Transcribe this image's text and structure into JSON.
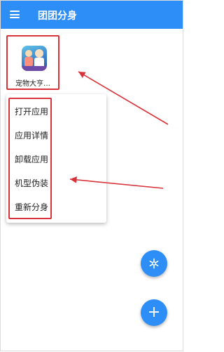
{
  "appbar": {
    "title": "团团分身",
    "menu_icon": "hamburger-menu-icon"
  },
  "app": {
    "label": "宠物大亨…",
    "icon": "pet-tycoon-app-icon"
  },
  "context_menu": {
    "items": [
      {
        "label": "打开应用"
      },
      {
        "label": "应用详情"
      },
      {
        "label": "卸载应用"
      },
      {
        "label": "机型伪装"
      },
      {
        "label": "重新分身"
      }
    ]
  },
  "fabs": {
    "settings_icon": "snowflake-settings-icon",
    "add_symbol": "+"
  },
  "colors": {
    "primary": "#2e8ef7",
    "annotation_red": "#d8333a"
  }
}
